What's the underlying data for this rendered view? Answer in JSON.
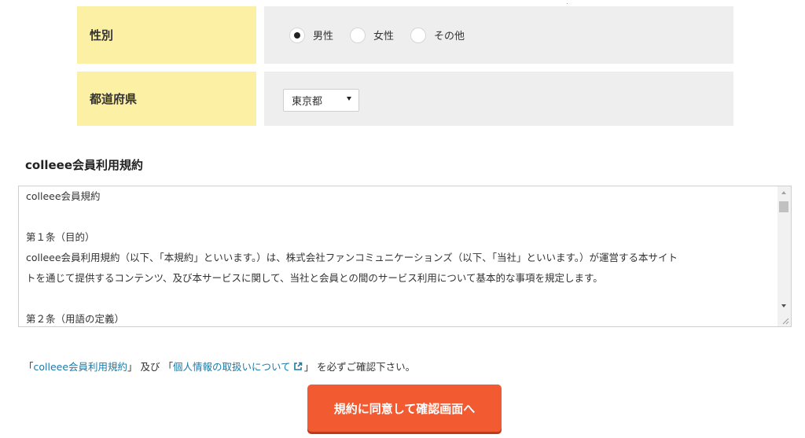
{
  "form": {
    "gender": {
      "label": "性別",
      "options": [
        {
          "label": "男性",
          "selected": true
        },
        {
          "label": "女性",
          "selected": false
        },
        {
          "label": "その他",
          "selected": false
        }
      ]
    },
    "prefecture": {
      "label": "都道府県",
      "selected_value": "東京都"
    }
  },
  "terms": {
    "section_title": "colleee会員利用規約",
    "lines": [
      "colleee会員規約",
      "",
      "第１条（目的）",
      "colleee会員利用規約（以下、「本規約」といいます。）は、株式会社ファンコミュニケーションズ（以下、「当社」といいます。）が運営する本サイト",
      "トを通じて提供するコンテンツ、及び本サービスに関して、当社と会員との間のサービス利用について基本的な事項を規定します。",
      "",
      "第２条（用語の定義）"
    ]
  },
  "notice": {
    "open_bracket_1": "「",
    "terms_link": "colleee会員利用規約",
    "close_bracket_1": "」",
    "conjunction": " 及び ",
    "open_bracket_2": "「",
    "privacy_link": "個人情報の取扱いについて",
    "close_bracket_2": "」",
    "suffix": " を必ずご確認下さい。"
  },
  "submit": {
    "label": "規約に同意して確認画面へ"
  },
  "colors": {
    "label_bg": "#fcf0a4",
    "value_bg": "#eeeeee",
    "link": "#1a7ba8",
    "button": "#f25a32",
    "button_shadow": "#b83b1e"
  }
}
